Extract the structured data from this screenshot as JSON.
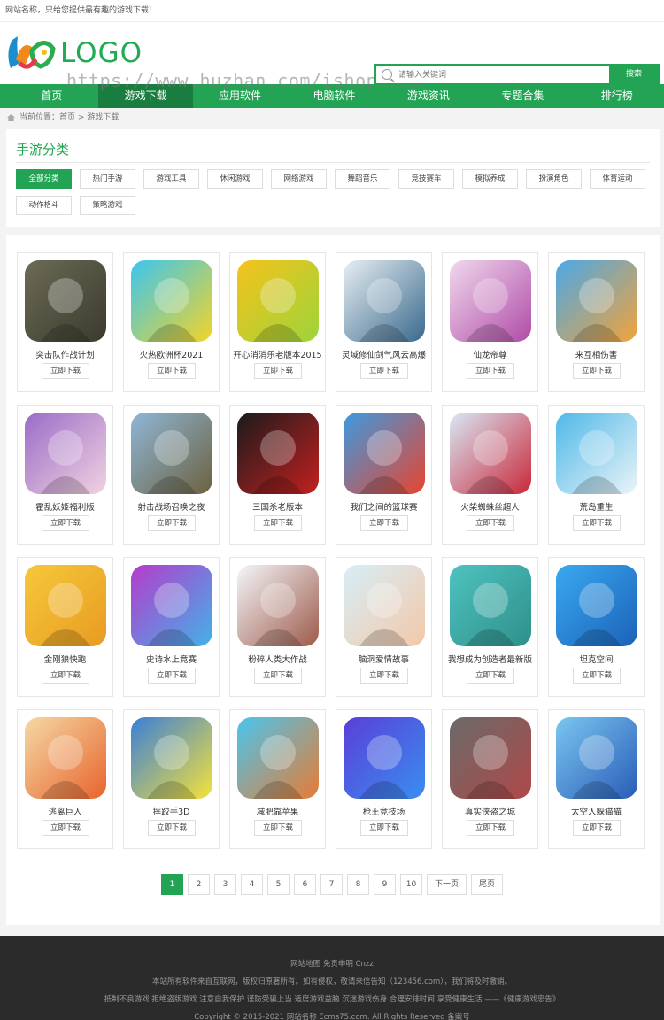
{
  "topbar": {
    "text": "网站名称，只给您提供最有趣的游戏下载！"
  },
  "logo": {
    "text": "LOGO"
  },
  "watermark": {
    "text": "https://www.huzhan.com/ishop4762"
  },
  "search": {
    "placeholder": "请输入关键词",
    "button": "搜索"
  },
  "nav": [
    {
      "label": "首页"
    },
    {
      "label": "游戏下载",
      "active": true
    },
    {
      "label": "应用软件"
    },
    {
      "label": "电脑软件"
    },
    {
      "label": "游戏资讯"
    },
    {
      "label": "专题合集"
    },
    {
      "label": "排行榜"
    }
  ],
  "breadcrumb": {
    "text": "当前位置：首页 > 游戏下载"
  },
  "category": {
    "title": "手游分类",
    "tags": [
      "全部分类",
      "热门手游",
      "游戏工具",
      "休闲游戏",
      "网络游戏",
      "舞蹈音乐",
      "竞技赛车",
      "模拟养成",
      "扮演角色",
      "体育运动",
      "动作格斗",
      "策略游戏"
    ]
  },
  "download_label": "立即下载",
  "games": [
    {
      "name": "突击队作战计划",
      "c1": "#6b6b55",
      "c2": "#3b3a2e"
    },
    {
      "name": "火热欧洲杯2021",
      "c1": "#3bc6f0",
      "c2": "#f3d427"
    },
    {
      "name": "开心消消乐老版本2015",
      "c1": "#f5c21c",
      "c2": "#9dd43a"
    },
    {
      "name": "灵域修仙剑气风云高爆",
      "c1": "#e8eef2",
      "c2": "#3a6a8e"
    },
    {
      "name": "仙龙帝尊",
      "c1": "#f0d8ec",
      "c2": "#b04ca8"
    },
    {
      "name": "来互相伤害",
      "c1": "#4ba8e8",
      "c2": "#f2a33a"
    },
    {
      "name": "霍乱妖姬福利版",
      "c1": "#9a6cc8",
      "c2": "#f1d2e0"
    },
    {
      "name": "射击战场召唤之夜",
      "c1": "#8fb6d6",
      "c2": "#6c6240"
    },
    {
      "name": "三国杀老版本",
      "c1": "#1b1b1b",
      "c2": "#c22020"
    },
    {
      "name": "我们之间的篮球赛",
      "c1": "#3c9ae0",
      "c2": "#e7452f"
    },
    {
      "name": "火柴蜘蛛丝超人",
      "c1": "#d8e8f5",
      "c2": "#c9283a"
    },
    {
      "name": "荒岛重生",
      "c1": "#4fb8e8",
      "c2": "#eaf4f8"
    },
    {
      "name": "金刚狼快跑",
      "c1": "#f5c83a",
      "c2": "#e99b22"
    },
    {
      "name": "史诗水上竞赛",
      "c1": "#b53ccb",
      "c2": "#42b2e8"
    },
    {
      "name": "粉碎人类大作战",
      "c1": "#f3f6fa",
      "c2": "#9e5a4a"
    },
    {
      "name": "脑洞爱情故事",
      "c1": "#d7eef8",
      "c2": "#f3c8a8"
    },
    {
      "name": "我想成为创造者最新版",
      "c1": "#4ec3c0",
      "c2": "#2f8f8a"
    },
    {
      "name": "坦克空间",
      "c1": "#3aa9f0",
      "c2": "#1b62b8"
    },
    {
      "name": "逃离巨人",
      "c1": "#f5d9a5",
      "c2": "#e8642c"
    },
    {
      "name": "摔跤手3D",
      "c1": "#3a7fd8",
      "c2": "#f5e23a"
    },
    {
      "name": "减肥靠苹果",
      "c1": "#48c6ef",
      "c2": "#e87b33"
    },
    {
      "name": "枪王竞技场",
      "c1": "#5a3fd8",
      "c2": "#3a8df0"
    },
    {
      "name": "真实侠盗之城",
      "c1": "#6a6a6a",
      "c2": "#b04848"
    },
    {
      "name": "太空人躲猫猫",
      "c1": "#7ac6f0",
      "c2": "#2a5cb8"
    }
  ],
  "pager": {
    "pages": [
      "1",
      "2",
      "3",
      "4",
      "5",
      "6",
      "7",
      "8",
      "9",
      "10"
    ],
    "next": "下一页",
    "last": "尾页",
    "current": "1"
  },
  "footer": {
    "links": "网站地图   免责申明   Cnzz",
    "notice": "本站所有软件来自互联网，版权归原著所有。如有侵权，敬请来信告知（123456.com），我们将及时撤销。",
    "health": "抵制不良游戏 拒绝盗版游戏 注意自我保护 谨防受骗上当 适度游戏益脑 沉迷游戏伤身 合理安排时间 享受健康生活 ——《健康游戏忠告》",
    "copyright": "Copyright © 2015-2021 网站名称 Ecms75.com. All Rights Reserved 备案号"
  }
}
